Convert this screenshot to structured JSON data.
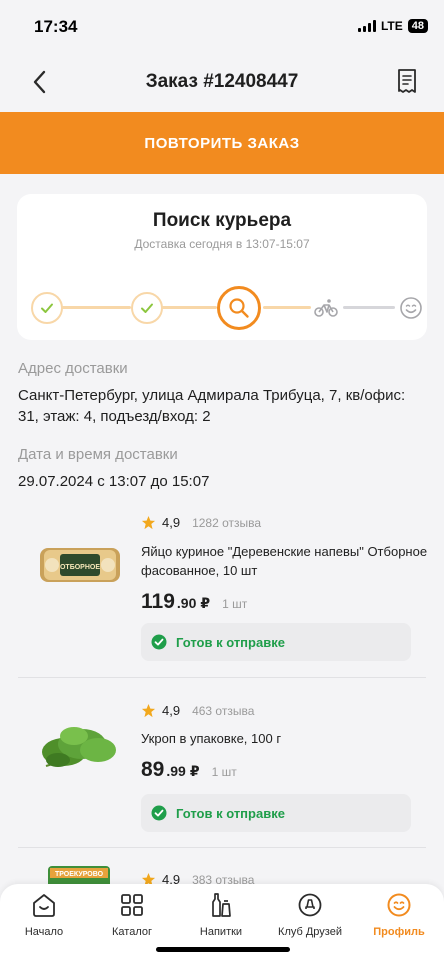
{
  "status_bar": {
    "time": "17:34",
    "network": "LTE",
    "battery": "48"
  },
  "header": {
    "title": "Заказ #12408447",
    "back_icon": "chevron-left-icon",
    "receipt_icon": "receipt-icon"
  },
  "repeat_button": {
    "label": "ПОВТОРИТЬ ЗАКАЗ"
  },
  "accent_color": "#f28b1f",
  "order_status": {
    "title": "Поиск курьера",
    "subtitle": "Доставка сегодня в  13:07-15:07",
    "steps": [
      {
        "icon": "check-icon",
        "state": "done"
      },
      {
        "icon": "check-icon",
        "state": "done"
      },
      {
        "icon": "search-icon",
        "state": "current"
      },
      {
        "icon": "bicycle-icon",
        "state": "pending"
      },
      {
        "icon": "smile-icon",
        "state": "pending"
      }
    ]
  },
  "delivery": {
    "address_label": "Адрес доставки",
    "address": "Санкт-Петербург, улица Адмирала Трибуца, 7, кв/офис: 31, этаж: 4, подъезд/вход: 2",
    "datetime_label": "Дата и время доставки",
    "datetime": "29.07.2024 с 13:07 до 15:07"
  },
  "products": [
    {
      "rating": "4,9",
      "reviews": "1282 отзыва",
      "name": "Яйцо куриное \"Деревенские напевы\" Отборное фасованное, 10 шт",
      "price_main": "119",
      "price_cents": ".90",
      "currency": "₽",
      "qty": "1 шт",
      "status": "Готов к отправке",
      "image_label": "ОТБОРНОЕ"
    },
    {
      "rating": "4,9",
      "reviews": "463 отзыва",
      "name": "Укроп в упаковке, 100 г",
      "price_main": "89",
      "price_cents": ".99",
      "currency": "₽",
      "qty": "1 шт",
      "status": "Готов к отправке"
    },
    {
      "rating": "4,9",
      "reviews": "383 отзыва",
      "image_label": "ТРОЕКУРОВО"
    }
  ],
  "bottom_nav": [
    {
      "label": "Начало",
      "icon": "home-icon"
    },
    {
      "label": "Каталог",
      "icon": "grid-icon"
    },
    {
      "label": "Напитки",
      "icon": "bottles-icon"
    },
    {
      "label": "Клуб Друзей",
      "icon": "club-icon"
    },
    {
      "label": "Профиль",
      "icon": "profile-icon",
      "active": true
    }
  ]
}
